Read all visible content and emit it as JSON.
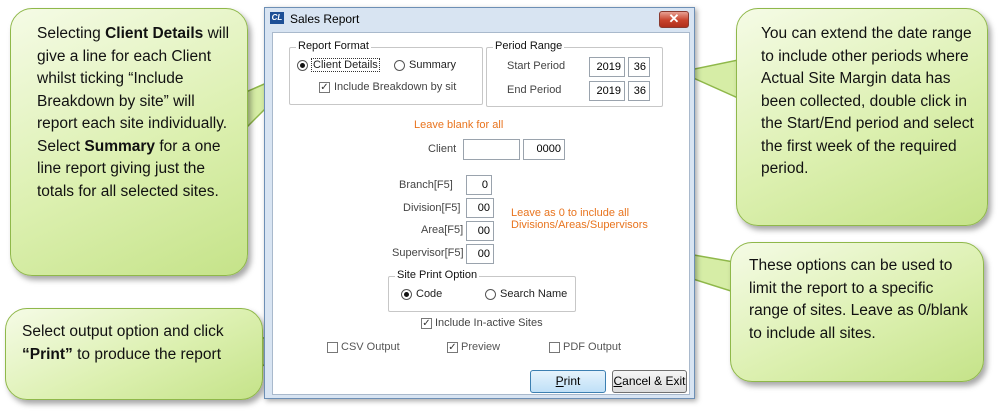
{
  "window": {
    "title": "Sales Report",
    "app_icon": "CL",
    "close_glyph": "✕"
  },
  "report_format": {
    "group_label": "Report Format",
    "client_details_label": "Client Details",
    "summary_label": "Summary",
    "selected": "client_details",
    "include_breakdown_label": "Include Breakdown by sit",
    "include_breakdown_checked": true
  },
  "period_range": {
    "group_label": "Period Range",
    "start_label": "Start Period",
    "start_year": "2019",
    "start_week": "36",
    "end_label": "End Period",
    "end_year": "2019",
    "end_week": "36"
  },
  "filters": {
    "blank_hint": "Leave blank for all",
    "client_label": "Client",
    "client_value": "",
    "client_code": "0000",
    "branch_label": "Branch[F5]",
    "branch_value": "0",
    "division_label": "Division[F5]",
    "division_value": "00",
    "area_label": "Area[F5]",
    "area_value": "00",
    "supervisor_label": "Supervisor[F5]",
    "supervisor_value": "00",
    "zero_hint_line1": "Leave as 0 to include all",
    "zero_hint_line2": "Divisions/Areas/Supervisors"
  },
  "site_print": {
    "group_label": "Site Print Option",
    "code_label": "Code",
    "search_name_label": "Search Name",
    "selected": "code"
  },
  "include_inactive": {
    "label": "Include In-active Sites",
    "checked": true
  },
  "outputs": {
    "csv_label": "CSV Output",
    "csv_checked": false,
    "preview_label": "Preview",
    "preview_checked": true,
    "pdf_label": "PDF Output",
    "pdf_checked": false
  },
  "buttons": {
    "print": "Print",
    "cancel": "Cancel & Exit"
  },
  "callouts": {
    "format_tip": {
      "t1": "Selecting ",
      "b1": "Client Details",
      "t2": " will give a line for each Client whilst ticking “Include Breakdown by site” will report each site individually. Select ",
      "b2": "Summary",
      "t3": " for a one line report giving just the totals for all selected sites."
    },
    "output_tip": {
      "t1": "Select output option and click ",
      "b1": "“Print”",
      "t2": " to produce the report"
    },
    "date_tip": "You can extend the date range to include other periods where Actual Site Margin data has been collected, double click in the Start/End period and select the first week of the required period.",
    "filter_tip": "These options can be used to limit the report to a specific range of sites. Leave as 0/blank to include all sites."
  },
  "colors": {
    "callout_fill": "#d6eda6",
    "callout_border": "#8fb84a",
    "hint_orange": "#e8741e",
    "dialog_frame": "#d8e4f2"
  }
}
